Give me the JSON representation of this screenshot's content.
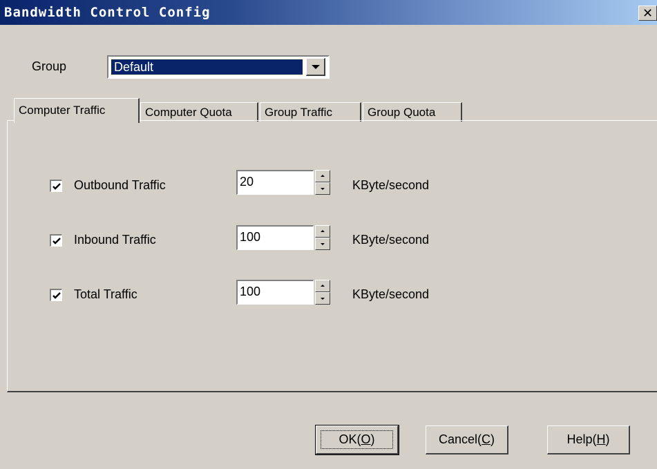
{
  "window": {
    "title": "Bandwidth Control Config",
    "close_glyph": "✕"
  },
  "group": {
    "label": "Group",
    "selected": "Default"
  },
  "tabs": [
    {
      "label": "Computer Traffic",
      "active": true
    },
    {
      "label": "Computer Quota",
      "active": false
    },
    {
      "label": "Group Traffic",
      "active": false
    },
    {
      "label": "Group Quota",
      "active": false
    }
  ],
  "traffic_rows": [
    {
      "label": "Outbound Traffic",
      "checked": true,
      "value": "20",
      "unit": "KByte/second"
    },
    {
      "label": "Inbound Traffic",
      "checked": true,
      "value": "100",
      "unit": "KByte/second"
    },
    {
      "label": "Total Traffic",
      "checked": true,
      "value": "100",
      "unit": "KByte/second"
    }
  ],
  "buttons": {
    "ok": "OK(O)",
    "cancel": "Cancel(C)",
    "help": "Help(H)"
  },
  "colors": {
    "face": "#d4d0c8",
    "title_start": "#0a246a",
    "title_end": "#a6caf0",
    "selection": "#0a246a"
  }
}
